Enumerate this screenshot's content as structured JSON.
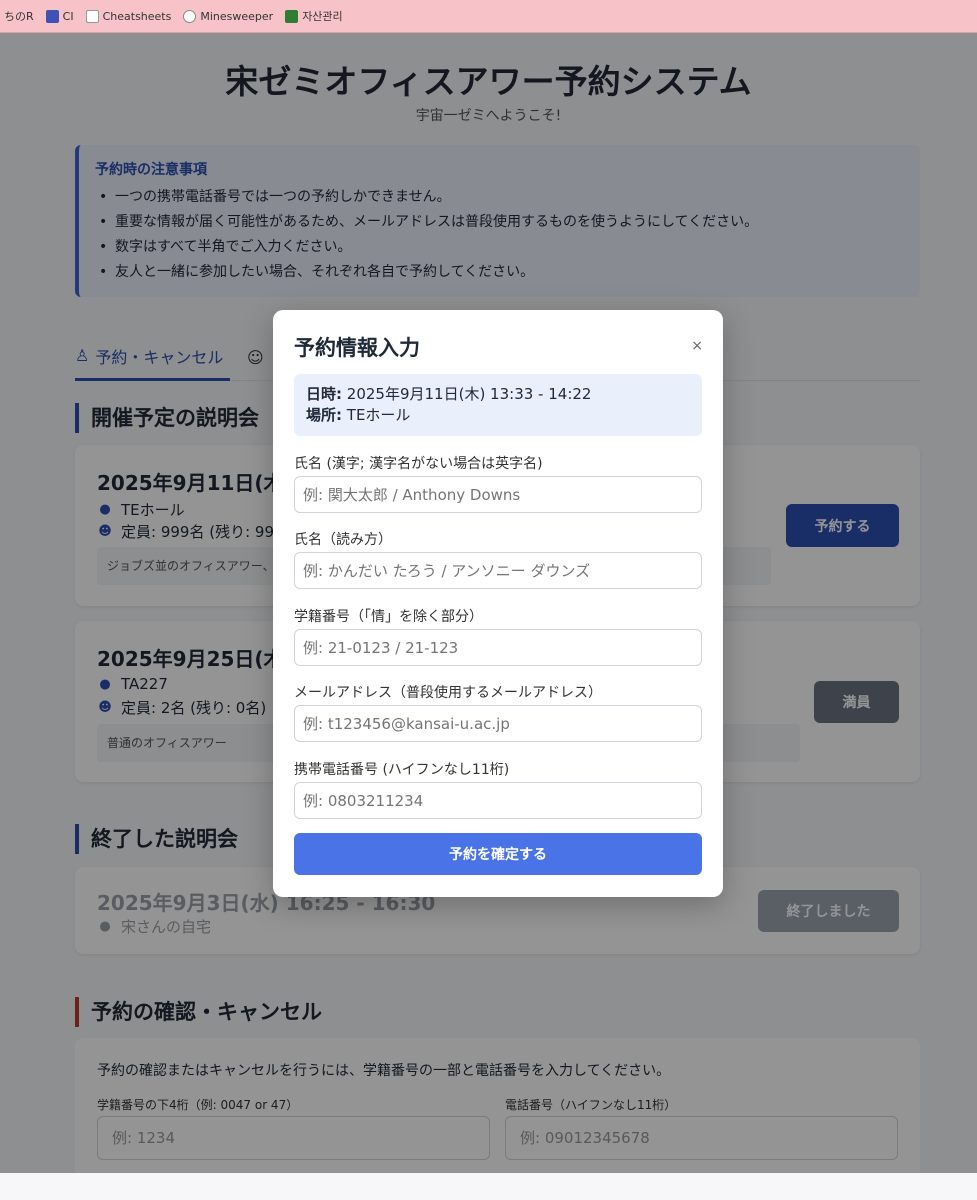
{
  "bookmarks": [
    {
      "label": "ちのR",
      "icon": "none"
    },
    {
      "label": "CI",
      "icon": "ci-icon"
    },
    {
      "label": "Cheatsheets",
      "icon": "cheatsheets-icon"
    },
    {
      "label": "Minesweeper",
      "icon": "minesweeper-icon"
    },
    {
      "label": "자산관리",
      "icon": "asset-icon"
    }
  ],
  "header": {
    "title": "宋ゼミオフィスアワー予約システム",
    "subtitle": "宇宙一ゼミへようこそ!"
  },
  "notice": {
    "title": "予約時の注意事項",
    "items": [
      "一つの携帯電話番号では一つの予約しかできません。",
      "重要な情報が届く可能性があるため、メールアドレスは普段使用するものを使うようにしてください。",
      "数字はすべて半角でご入力ください。",
      "友人と一緒に参加したい場合、それぞれ各自で予約してください。"
    ]
  },
  "tabs": {
    "active_label": "予約・キャンセル"
  },
  "upcoming": {
    "heading": "開催予定の説明会",
    "sessions": [
      {
        "date": "2025年9月11日(木)",
        "place": "TEホール",
        "capacity": "定員: 999名 (残り: 999",
        "desc": "ジョブズ並のオフィスアワー、",
        "button": "予約する"
      },
      {
        "date": "2025年9月25日(木)",
        "place": "TA227",
        "capacity": "定員: 2名 (残り: 0名)",
        "desc": "普通のオフィスアワー",
        "button": "満員"
      }
    ]
  },
  "past": {
    "heading": "終了した説明会",
    "session": {
      "date": "2025年9月3日(水) 16:25 - 16:30",
      "place": "宋さんの自宅",
      "button": "終了しました"
    }
  },
  "confirm": {
    "heading": "予約の確認・キャンセル",
    "text": "予約の確認またはキャンセルを行うには、学籍番号の一部と電話番号を入力してください。",
    "student_label": "学籍番号の下4桁（例: 0047 or 47）",
    "student_placeholder": "例: 1234",
    "phone_label": "電話番号（ハイフンなし11桁）",
    "phone_placeholder": "例: 09012345678"
  },
  "modal": {
    "title": "予約情報入力",
    "close": "×",
    "datetime_label": "日時:",
    "datetime_value": "2025年9月11日(木) 13:33 - 14:22",
    "place_label": "場所:",
    "place_value": "TEホール",
    "fields": [
      {
        "label": "氏名 (漢字; 漢字名がない場合は英字名)",
        "placeholder": "例: 関大太郎 / Anthony Downs"
      },
      {
        "label": "氏名（読み方）",
        "placeholder": "例: かんだい たろう / アンソニー ダウンズ"
      },
      {
        "label": "学籍番号（「情」を除く部分）",
        "placeholder": "例: 21-0123 / 21-123"
      },
      {
        "label": "メールアドレス（普段使用するメールアドレス）",
        "placeholder": "例: t123456@kansai-u.ac.jp"
      },
      {
        "label": "携帯電話番号 (ハイフンなし11桁)",
        "placeholder": "例: 0803211234"
      }
    ],
    "submit": "予約を確定する"
  }
}
